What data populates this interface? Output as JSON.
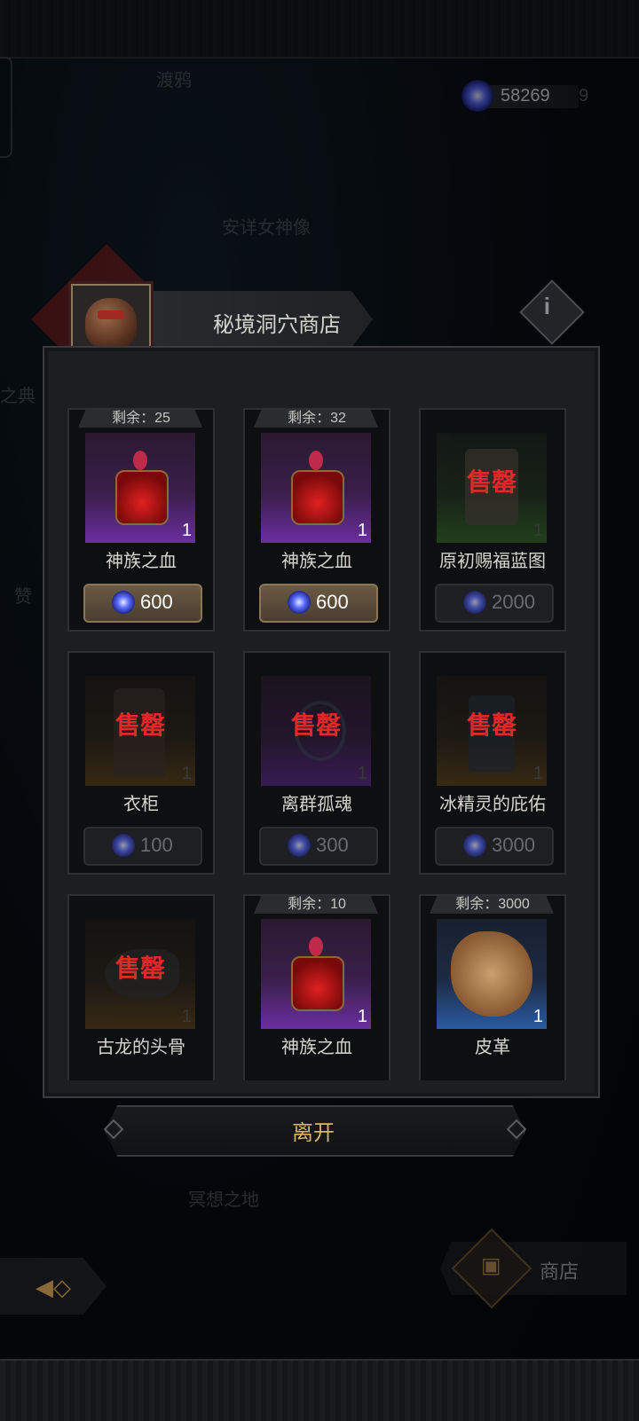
{
  "background": {
    "location_top": "渡鸦",
    "location_mid": "安详女神像",
    "location_bottom": "冥想之地",
    "left_fragment_1": "之典",
    "left_fragment_2": "赞"
  },
  "currency": {
    "value": "58269",
    "ghost_digit": "9",
    "icon": "blue-portal-orb-icon"
  },
  "shop": {
    "title": "秘境洞穴商店",
    "info_icon": "i",
    "items": [
      {
        "stock": "剩余：25",
        "name": "神族之血",
        "qty": "1",
        "price": "600",
        "sold_out": false,
        "rarity": "purple"
      },
      {
        "stock": "剩余：32",
        "name": "神族之血",
        "qty": "1",
        "price": "600",
        "sold_out": false,
        "rarity": "purple"
      },
      {
        "stock": "",
        "name": "原初赐福蓝图",
        "qty": "1",
        "price": "2000",
        "sold_out": true,
        "rarity": "green"
      },
      {
        "stock": "",
        "name": "衣柜",
        "qty": "1",
        "price": "100",
        "sold_out": true,
        "rarity": "orange"
      },
      {
        "stock": "",
        "name": "离群孤魂",
        "qty": "1",
        "price": "300",
        "sold_out": true,
        "rarity": "purple"
      },
      {
        "stock": "",
        "name": "冰精灵的庇佑",
        "qty": "1",
        "price": "3000",
        "sold_out": true,
        "rarity": "orange"
      },
      {
        "stock": "",
        "name": "古龙的头骨",
        "qty": "1",
        "price": "",
        "sold_out": true,
        "rarity": "orange"
      },
      {
        "stock": "剩余：10",
        "name": "神族之血",
        "qty": "1",
        "price": "",
        "sold_out": false,
        "rarity": "purple"
      },
      {
        "stock": "剩余：3000",
        "name": "皮革",
        "qty": "1",
        "price": "",
        "sold_out": false,
        "rarity": "blue"
      }
    ],
    "sold_out_label": "售罄"
  },
  "leave_button": "离开",
  "bottom_nav": {
    "shop_label": "商店"
  },
  "colors": {
    "accent_gold": "#d8b46a",
    "sold_out_red": "#e02a2a",
    "panel_bg": "#1d1e21"
  }
}
